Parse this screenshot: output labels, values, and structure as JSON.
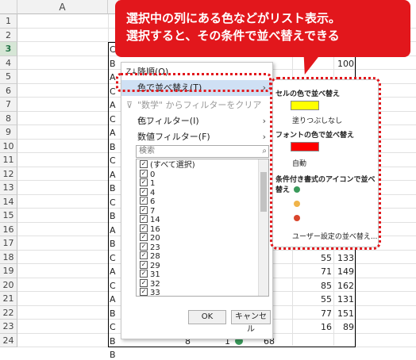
{
  "sheet": {
    "column_header": "A",
    "row_numbers": [
      "1",
      "2",
      "3",
      "4",
      "5",
      "6",
      "7",
      "8",
      "9",
      "10",
      "11",
      "12",
      "13",
      "14",
      "15",
      "16",
      "17",
      "18",
      "19",
      "20",
      "21",
      "22",
      "23",
      "24"
    ],
    "selected_row": "3",
    "col_a_letters": [
      "C",
      "B",
      "A",
      "C",
      "A",
      "C",
      "A",
      "B",
      "C",
      "A",
      "B",
      "C",
      "B",
      "A",
      "B",
      "C",
      "A",
      "C",
      "A",
      "B",
      "C",
      "B",
      "B"
    ],
    "visible_numbers": {
      "r4_val": "100",
      "rows": [
        {
          "row": "18",
          "v1": "55",
          "v2": "133"
        },
        {
          "row": "19",
          "v1": "71",
          "v2": "149"
        },
        {
          "row": "20",
          "v1": "85",
          "v2": "162"
        },
        {
          "row": "21",
          "v1": "55",
          "v2": "131"
        },
        {
          "row": "22",
          "v1": "77",
          "v2": "151"
        },
        {
          "row": "23",
          "v1": "16",
          "v2": "89"
        }
      ],
      "r24": {
        "a": "8",
        "b": "1",
        "c": "68"
      }
    }
  },
  "callout": {
    "line1": "選択中の列にある色などがリスト表示。",
    "line2": "選択すると、その条件で並べ替えできる"
  },
  "menu": {
    "sort_desc": "降順(O)",
    "sort_by_color": "色で並べ替え(T)",
    "filter_clear": "\"数学\" からフィルターをクリア(C)",
    "color_filter": "色フィルター(I)",
    "number_filter": "数値フィルター(F)",
    "search_placeholder": "検索",
    "list_items": [
      "(すべて選択)",
      "0",
      "1",
      "4",
      "6",
      "7",
      "14",
      "16",
      "20",
      "23",
      "28",
      "29",
      "31",
      "32",
      "33"
    ],
    "ok": "OK",
    "cancel": "キャンセル"
  },
  "submenu": {
    "cell_color_header": "セルの色で並べ替え",
    "cell_color_swatch": "#ffff00",
    "no_fill": "塗りつぶしなし",
    "font_color_header": "フォントの色で並べ替え",
    "font_color_swatch": "#ff0000",
    "auto": "自動",
    "icon_header": "条件付き書式のアイコンで並べ替え",
    "icon_colors": [
      "#3a9a5b",
      "#f0b44a",
      "#d9452c"
    ],
    "custom_sort": "ユーザー設定の並べ替え..."
  },
  "colors": {
    "accent": "#e2171c",
    "highlight": "#cfe0f4"
  }
}
